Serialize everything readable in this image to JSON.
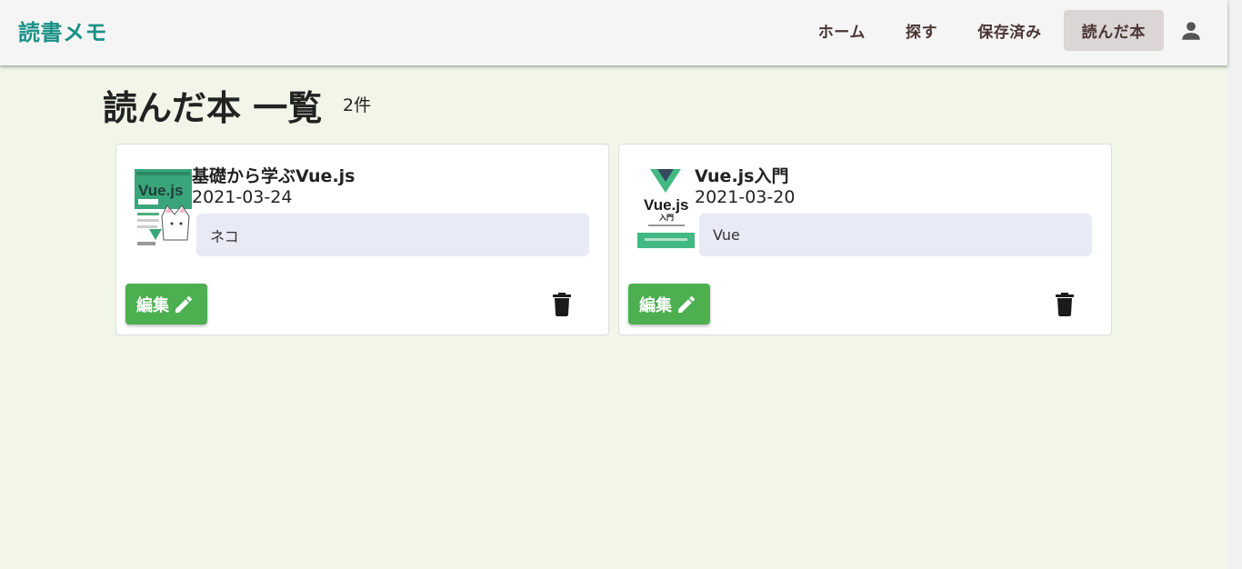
{
  "app": {
    "brand": "読書メモ"
  },
  "nav": {
    "items": [
      {
        "label": "ホーム"
      },
      {
        "label": "探す"
      },
      {
        "label": "保存済み"
      },
      {
        "label": "読んだ本",
        "active": true
      }
    ],
    "account_icon": "account-icon"
  },
  "page": {
    "title": "読んだ本 一覧",
    "count": "2件"
  },
  "books": [
    {
      "title": "基礎から学ぶVue.js",
      "date": "2021-03-24",
      "memo": "ネコ",
      "edit_label": "編集",
      "cover_text": "Vue.js"
    },
    {
      "title": "Vue.js入門",
      "date": "2021-03-20",
      "memo": "Vue",
      "edit_label": "編集",
      "cover_text": "Vue.js",
      "cover_subtext": "入門"
    }
  ],
  "colors": {
    "brand": "#199187",
    "edit_button": "#4caf50",
    "memo_bg": "#e8eaf6",
    "page_bg": "#f1f6e9",
    "nav_text": "#4b3434"
  },
  "icons": {
    "edit": "pencil-icon",
    "delete": "trash-icon"
  }
}
